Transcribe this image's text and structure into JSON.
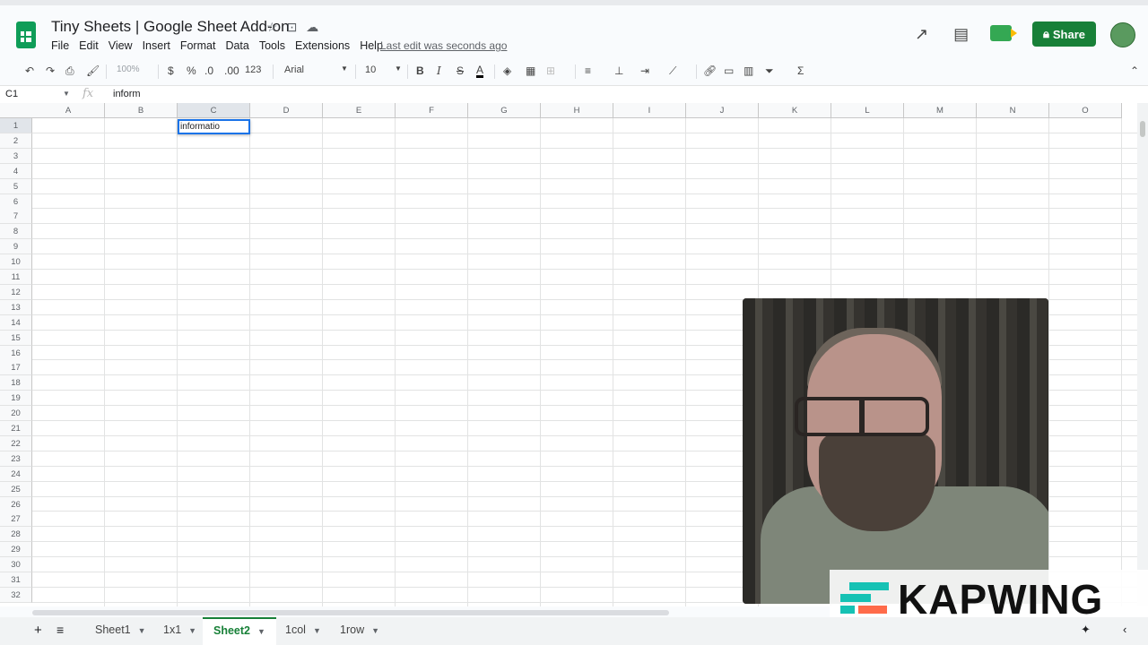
{
  "doc": {
    "title": "Tiny Sheets | Google Sheet Add-on",
    "last_edit": "Last edit was seconds ago"
  },
  "menu": [
    "File",
    "Edit",
    "View",
    "Insert",
    "Format",
    "Data",
    "Tools",
    "Extensions",
    "Help"
  ],
  "header_actions": {
    "share_label": "Share"
  },
  "toolbar": {
    "zoom": "100%",
    "currency": "$",
    "percent": "%",
    "dec_decrease": ".0",
    "dec_increase": ".00",
    "format_more": "123",
    "font": "Arial",
    "font_size": "10",
    "bold": "B",
    "italic": "I",
    "strike": "S",
    "text_color": "A",
    "functions": "Σ"
  },
  "formula_bar": {
    "cell_ref": "C1",
    "fx": "fx",
    "value": "inform"
  },
  "columns": [
    "A",
    "B",
    "C",
    "D",
    "E",
    "F",
    "G",
    "H",
    "I",
    "J",
    "K",
    "L",
    "M",
    "N",
    "O"
  ],
  "rows": [
    "1",
    "2",
    "3",
    "4",
    "5",
    "6",
    "7",
    "8",
    "9",
    "10",
    "11",
    "12",
    "13",
    "14",
    "15",
    "16",
    "17",
    "18",
    "19",
    "20",
    "21",
    "22",
    "23",
    "24",
    "25",
    "26",
    "27",
    "28",
    "29",
    "30",
    "31",
    "32"
  ],
  "active_cell": {
    "col": "C",
    "row": "1",
    "edit_text": "informatio"
  },
  "sheet_tabs": [
    {
      "label": "Sheet1",
      "active": false
    },
    {
      "label": "1x1",
      "active": false
    },
    {
      "label": "Sheet2",
      "active": true
    },
    {
      "label": "1col",
      "active": false
    },
    {
      "label": "1row",
      "active": false
    }
  ],
  "overlay": {
    "watermark": "KAPWING"
  },
  "colors": {
    "share_green": "#188038",
    "active_blue": "#1a73e8",
    "kapwing_teal": "#16c2b4",
    "kapwing_orange": "#ff6b4a"
  }
}
